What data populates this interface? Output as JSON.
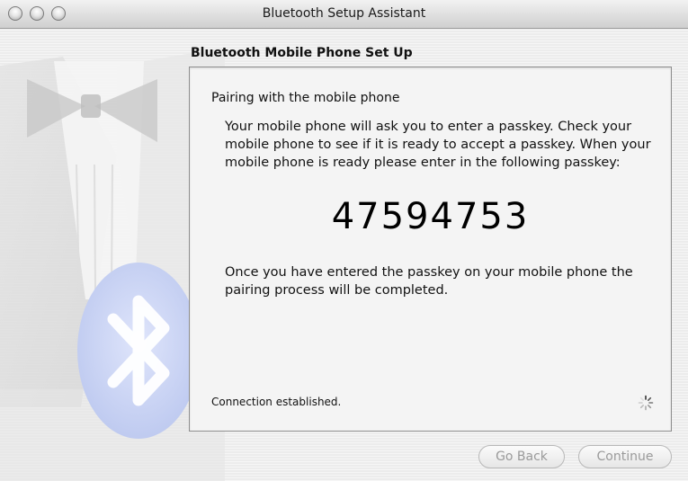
{
  "window": {
    "title": "Bluetooth Setup Assistant"
  },
  "section": {
    "title": "Bluetooth Mobile Phone Set Up"
  },
  "panel": {
    "heading": "Pairing with the mobile phone",
    "instructions": "Your mobile phone will ask you to enter a passkey. Check your mobile phone to see if it is ready to accept a passkey. When your mobile phone is ready please enter in the following passkey:",
    "passkey": "47594753",
    "completion": "Once you have entered the passkey on your mobile phone the pairing process will be completed.",
    "status": "Connection established."
  },
  "buttons": {
    "back_label": "Go Back",
    "continue_label": "Continue"
  },
  "icons": {
    "sidebar": "bluetooth-icon",
    "spinner": "spinner-icon"
  },
  "colors": {
    "bluetooth_oval": "#c8d2f2",
    "panel_background": "#f4f4f4",
    "disabled_text": "#9a9a9a"
  }
}
